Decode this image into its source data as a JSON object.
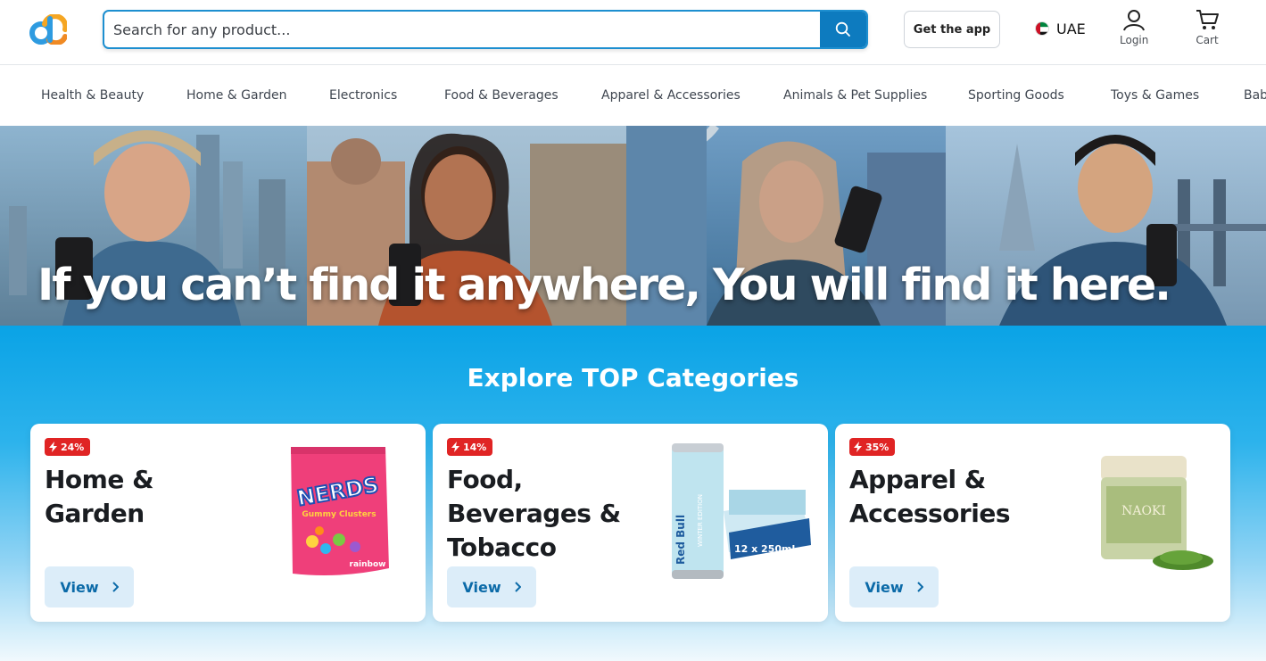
{
  "header": {
    "logo_alt": "dc",
    "search": {
      "placeholder": "Search for any product..."
    },
    "get_app_label": "Get the app",
    "country": "UAE",
    "login_label": "Login",
    "cart_label": "Cart"
  },
  "categories_nav": [
    "Health & Beauty",
    "Home & Garden",
    "Electronics",
    "Food & Beverages",
    "Apparel & Accessories",
    "Animals & Pet Supplies",
    "Sporting Goods",
    "Toys & Games",
    "Baby"
  ],
  "hero": {
    "headline": "If you can’t find it anywhere, You will find it here."
  },
  "top_categories": {
    "title": "Explore TOP Categories",
    "cards": [
      {
        "discount": "24%",
        "title_line1": "Home &",
        "title_line2": "Garden",
        "title_line3": "",
        "view_label": "View",
        "product_label": "Nerds Gummy Clusters",
        "product_brand": "NERDS",
        "product_sub": "Gummy Clusters",
        "product_flavor": "rainbow"
      },
      {
        "discount": "14%",
        "title_line1": "Food,",
        "title_line2": "Beverages &",
        "title_line3": "Tobacco",
        "view_label": "View",
        "product_label": "Red Bull Winter Edition",
        "product_brand": "Red Bull",
        "product_sub": "WINTER EDITION",
        "product_pack": "12 x 250ml"
      },
      {
        "discount": "35%",
        "title_line1": "Apparel &",
        "title_line2": "Accessories",
        "title_line3": "",
        "view_label": "View",
        "product_label": "Naoki Matcha",
        "product_brand": "NAOKI"
      }
    ]
  },
  "colors": {
    "accent": "#0d7bbf",
    "section_bg": "#0aa3e6",
    "badge": "#e02424",
    "view_btn_bg": "#dcedf9",
    "view_btn_text": "#0b6aa8"
  }
}
